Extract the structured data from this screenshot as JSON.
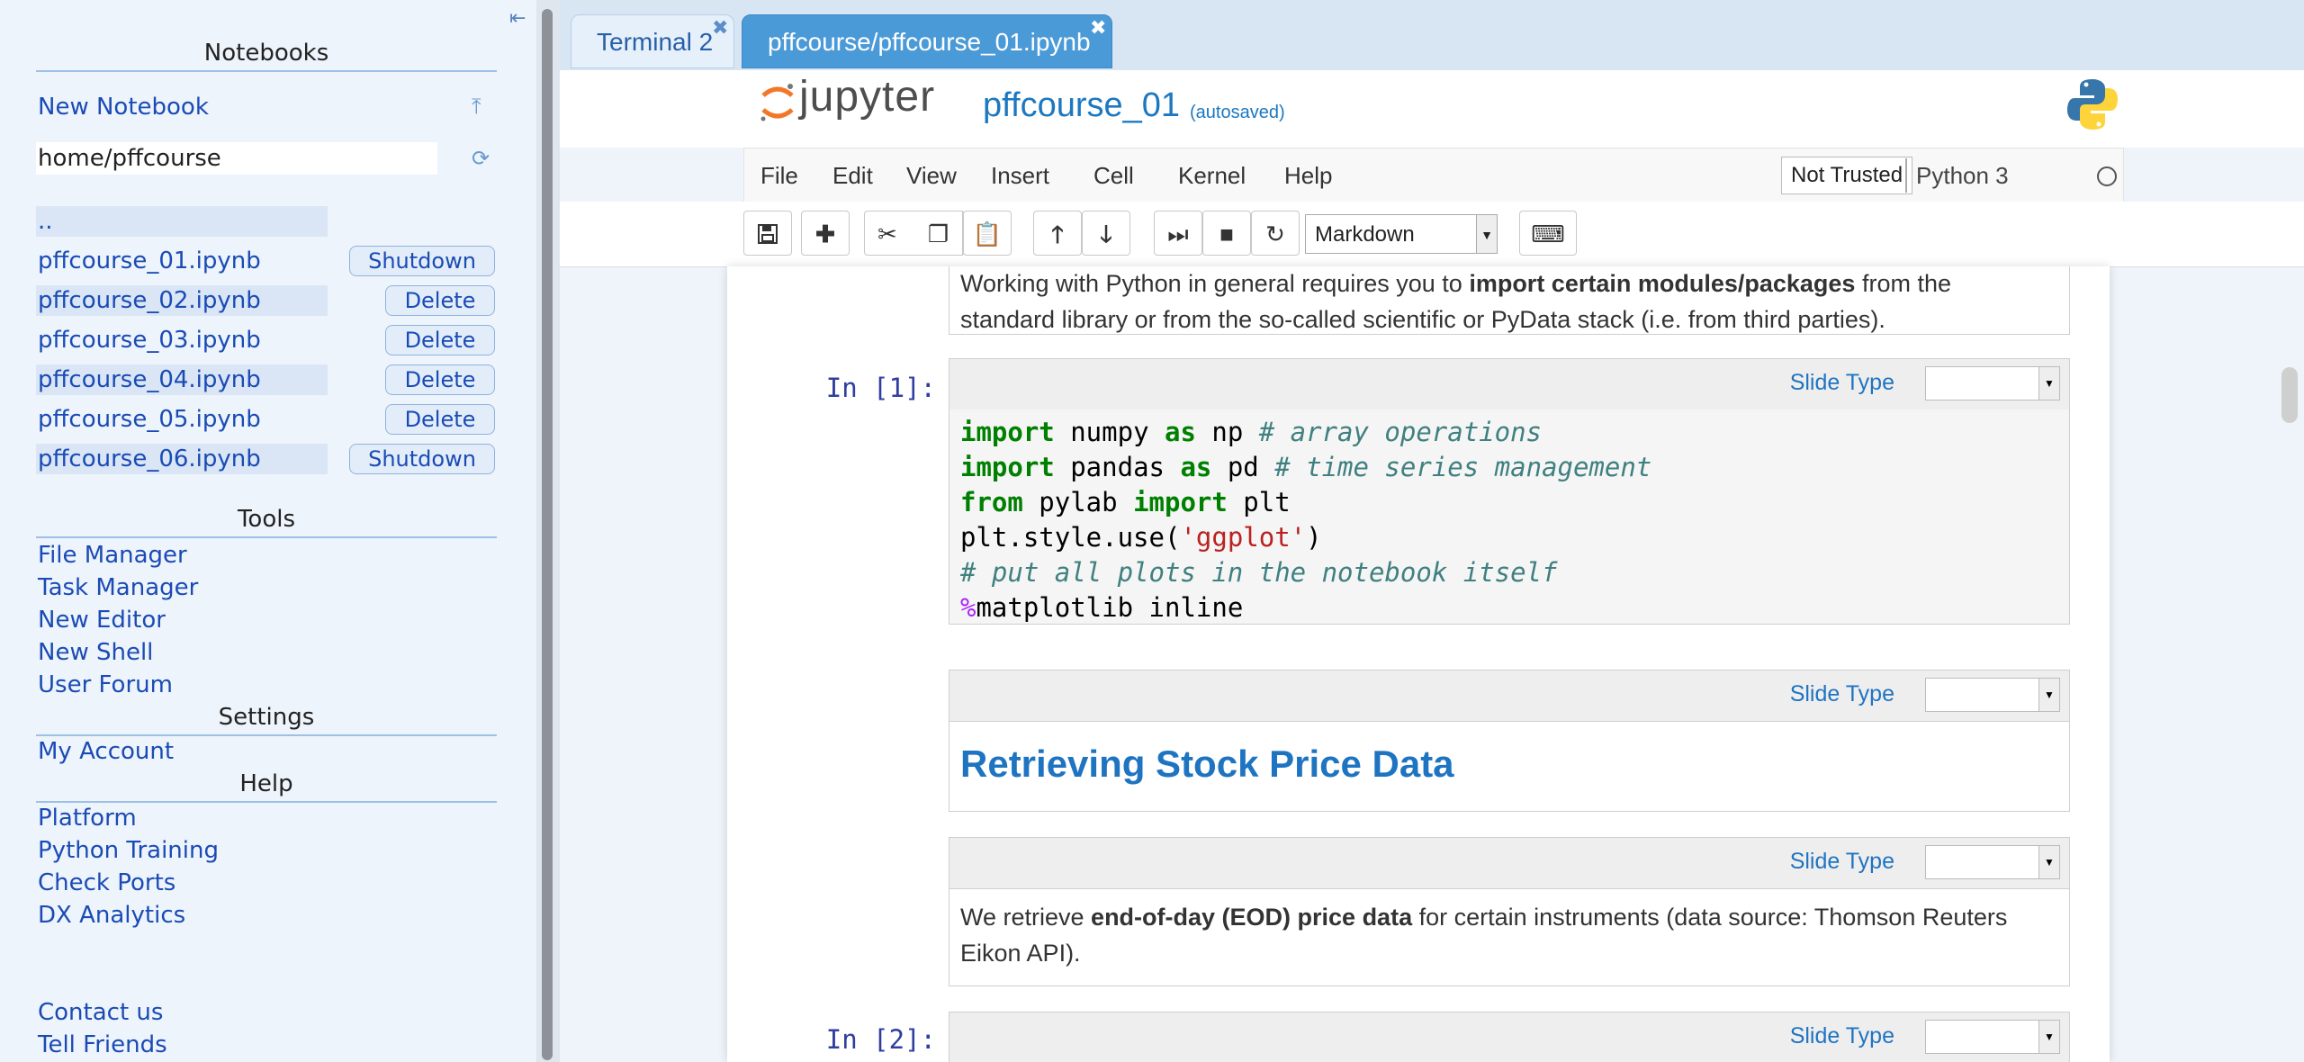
{
  "sidebar": {
    "notebooks_title": "Notebooks",
    "new_notebook": "New Notebook",
    "path": "home/pffcourse",
    "parent_dir": "..",
    "files": [
      {
        "name": "pffcourse_01.ipynb",
        "action": "Shutdown"
      },
      {
        "name": "pffcourse_02.ipynb",
        "action": "Delete"
      },
      {
        "name": "pffcourse_03.ipynb",
        "action": "Delete"
      },
      {
        "name": "pffcourse_04.ipynb",
        "action": "Delete"
      },
      {
        "name": "pffcourse_05.ipynb",
        "action": "Delete"
      },
      {
        "name": "pffcourse_06.ipynb",
        "action": "Shutdown"
      }
    ],
    "tools_title": "Tools",
    "tools": [
      "File Manager",
      "Task Manager",
      "New Editor",
      "New Shell",
      "User Forum"
    ],
    "settings_title": "Settings",
    "settings": [
      "My Account"
    ],
    "help_title": "Help",
    "help": [
      "Platform",
      "Python Training",
      "Check Ports",
      "DX Analytics"
    ],
    "footer": [
      "Contact us",
      "Tell Friends"
    ]
  },
  "tabs": [
    {
      "label": "Terminal 2",
      "active": false
    },
    {
      "label": "pffcourse/pffcourse_01.ipynb",
      "active": true
    }
  ],
  "header": {
    "brand": "jupyter",
    "notebook_name": "pffcourse_01",
    "save_status": "(autosaved)"
  },
  "menu": [
    "File",
    "Edit",
    "View",
    "Insert",
    "Cell",
    "Kernel",
    "Help"
  ],
  "trust": "Not Trusted",
  "kernel": "Python 3",
  "toolbar": {
    "cell_type": "Markdown",
    "icons": [
      "save-icon",
      "plus-icon",
      "cut-icon",
      "copy-icon",
      "paste-icon",
      "arrow-up-icon",
      "arrow-down-icon",
      "run-icon",
      "stop-icon",
      "restart-icon",
      "keyboard-icon"
    ]
  },
  "cells": {
    "intro_text_1": "Working with Python in general requires you to ",
    "intro_bold": "import certain modules/packages",
    "intro_text_2": " from the",
    "intro_line2": "standard library or from the so-called scientific or PyData stack (i.e. from third parties).",
    "slide_type_label": "Slide Type",
    "prompt1": "In [1]:",
    "prompt2": "In [2]:",
    "heading": "Retrieving Stock Price Data",
    "eod_pre": "We retrieve ",
    "eod_bold": "end-of-day (EOD) price data",
    "eod_post": " for certain instruments (data source: Thomson Reuters",
    "eod_line2": "Eikon API).",
    "code": {
      "l1_kw1": "import",
      "l1_mod": " numpy ",
      "l1_kw2": "as",
      "l1_alias": " np  ",
      "l1_cm": "# array operations",
      "l2_kw1": "import",
      "l2_mod": " pandas ",
      "l2_kw2": "as",
      "l2_alias": " pd  ",
      "l2_cm": "# time series management",
      "l3_kw1": "from",
      "l3_mod": " pylab ",
      "l3_kw2": "import",
      "l3_name": " plt",
      "l4_pre": "plt.style.use(",
      "l4_str": "'ggplot'",
      "l4_post": ")",
      "l5_cm": "# put all plots in the notebook itself",
      "l6_mg": "%",
      "l6_rest": "matplotlib inline"
    }
  },
  "colors": {
    "accent": "#1f74c2",
    "sidebar_link": "#1a4bb5",
    "tab_active": "#4b9ad8"
  }
}
